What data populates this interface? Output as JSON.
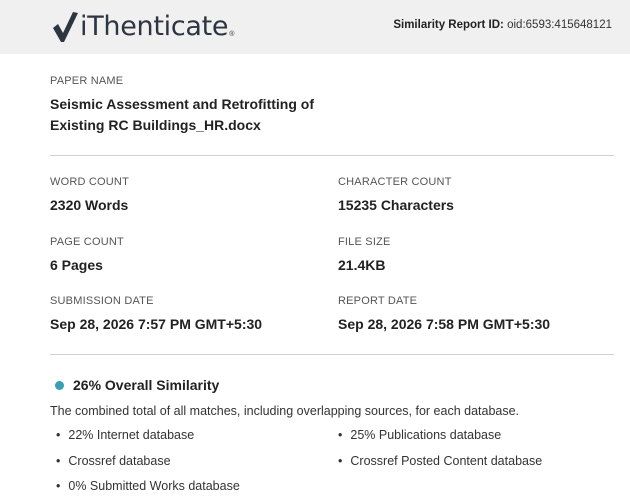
{
  "brand": {
    "name": "iThenticate",
    "reg_mark": "®"
  },
  "report": {
    "id_label": "Similarity Report ID:",
    "id_value": "oid:6593:415648121"
  },
  "paper": {
    "name_label": "PAPER NAME",
    "name_line1": "Seismic Assessment and Retrofitting of",
    "name_line2": "Existing RC Buildings_HR.docx"
  },
  "stats": {
    "word_count_label": "WORD COUNT",
    "word_count": "2320 Words",
    "character_count_label": "CHARACTER COUNT",
    "character_count": "15235 Characters",
    "page_count_label": "PAGE COUNT",
    "page_count": "6 Pages",
    "file_size_label": "FILE SIZE",
    "file_size": "21.4KB",
    "submission_date_label": "SUBMISSION DATE",
    "submission_date": "Sep 28, 2026 7:57 PM GMT+5:30",
    "report_date_label": "REPORT DATE",
    "report_date": "Sep 28, 2026 7:58 PM GMT+5:30"
  },
  "similarity": {
    "title": "26% Overall Similarity",
    "dot_color": "#3a9fb2",
    "description": "The combined total of all matches, including overlapping sources, for each database.",
    "databases": [
      "22% Internet database",
      "25% Publications database",
      "Crossref database",
      "Crossref Posted Content database",
      "0% Submitted Works database"
    ]
  }
}
